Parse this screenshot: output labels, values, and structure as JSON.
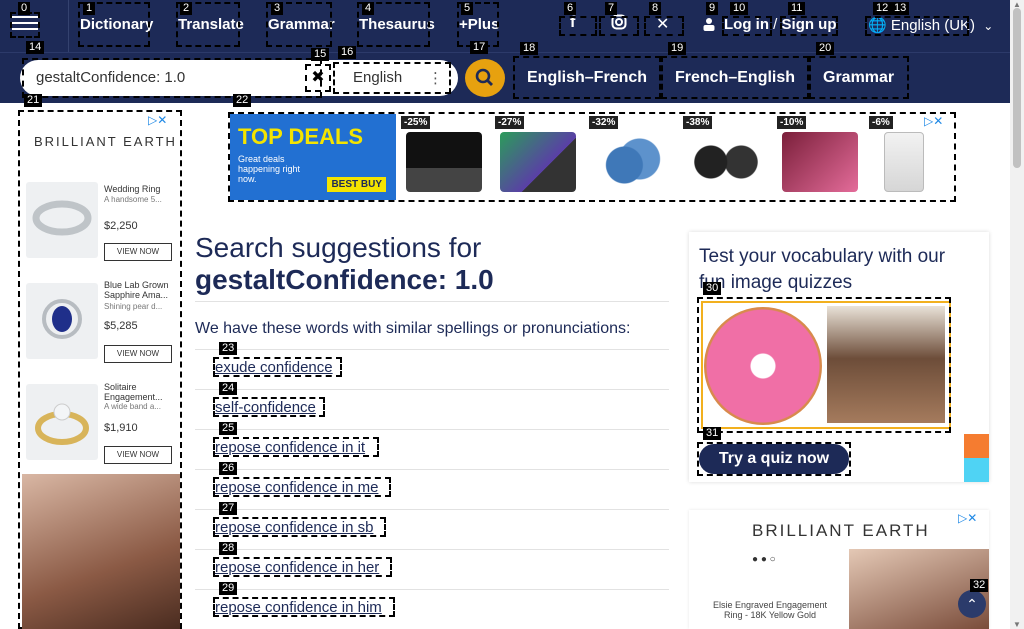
{
  "nav": {
    "links": [
      "Dictionary",
      "Translate",
      "Grammar",
      "Thesaurus",
      "+Plus"
    ],
    "login": "Log in",
    "slash": "/",
    "signup": "Sign up",
    "language": "English (UK)"
  },
  "search": {
    "value": "gestaltConfidence: 1.0",
    "dictionary": "English",
    "tabs": [
      "English–French",
      "French–English",
      "Grammar"
    ]
  },
  "badges": [
    "0",
    "1",
    "2",
    "3",
    "4",
    "5",
    "6",
    "7",
    "8",
    "9",
    "10",
    "11",
    "12",
    "13",
    "14",
    "15",
    "16",
    "17",
    "18",
    "19",
    "20",
    "21",
    "22",
    "23",
    "24",
    "25",
    "26",
    "27",
    "28",
    "29",
    "30",
    "31",
    "32"
  ],
  "left_ad": {
    "brand": "BRILLIANT EARTH",
    "products": [
      {
        "title": "Wedding Ring",
        "sub": "A handsome 5...",
        "price": "$2,250",
        "cta": "VIEW NOW"
      },
      {
        "title": "Blue Lab Grown Sapphire Ama...",
        "sub": "Shining pear d...",
        "price": "$5,285",
        "cta": "VIEW NOW"
      },
      {
        "title": "Solitaire Engagement...",
        "sub": "A wide band a...",
        "price": "$1,910",
        "cta": "VIEW NOW"
      }
    ]
  },
  "top_ad": {
    "headline": "TOP DEALS",
    "text": "Great deals happening right now.",
    "logo": "BEST BUY",
    "discounts": [
      "-25%",
      "-27%",
      "-32%",
      "-38%",
      "-10%",
      "-6%"
    ]
  },
  "main": {
    "heading_line1": "Search suggestions for",
    "heading_line2": "gestaltConfidence: 1.0",
    "intro": "We have these words with similar spellings or pronunciations:",
    "suggestions": [
      "exude confidence",
      "self-confidence",
      "repose confidence in it",
      "repose confidence in me",
      "repose confidence in sb",
      "repose confidence in her",
      "repose confidence in him"
    ]
  },
  "quiz": {
    "title": "Test your vocabulary with our fun image quizzes",
    "button": "Try a quiz now"
  },
  "right_ad": {
    "brand": "BRILLIANT EARTH",
    "caption": "Elsie Engraved Engagement Ring - 18K Yellow Gold"
  },
  "colors": {
    "navy": "#1d2a57",
    "accent": "#e7a10f",
    "link": "#1e88e5"
  }
}
